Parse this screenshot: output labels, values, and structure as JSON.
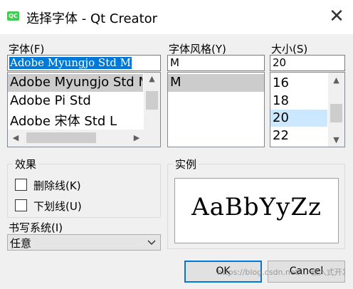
{
  "window": {
    "title": "选择字体 - Qt Creator",
    "icon_text": "QC",
    "close_glyph": "✕"
  },
  "font": {
    "label": "字体(F)",
    "value": "Adobe Myungjo Std M",
    "items": [
      "Adobe Myungjo Std M",
      "Adobe Pi Std",
      "Adobe 宋体 Std L"
    ],
    "selected_index": 0
  },
  "style": {
    "label": "字体风格(Y)",
    "value": "M",
    "items": [
      "M"
    ],
    "selected_index": 0
  },
  "size": {
    "label": "大小(S)",
    "value": "20",
    "items": [
      "16",
      "18",
      "20",
      "22"
    ],
    "selected_index": 2
  },
  "effects": {
    "label": "效果",
    "strikeout": "删除线(K)",
    "underline": "下划线(U)"
  },
  "sample": {
    "label": "实例",
    "text": "AaBbYyZz"
  },
  "writing_system": {
    "label": "书写系统(I)",
    "value": "任意"
  },
  "buttons": {
    "ok": "OK",
    "cancel": "Cancel"
  },
  "watermark": "https://blog.csdn.net/... 嵌入式开发"
}
